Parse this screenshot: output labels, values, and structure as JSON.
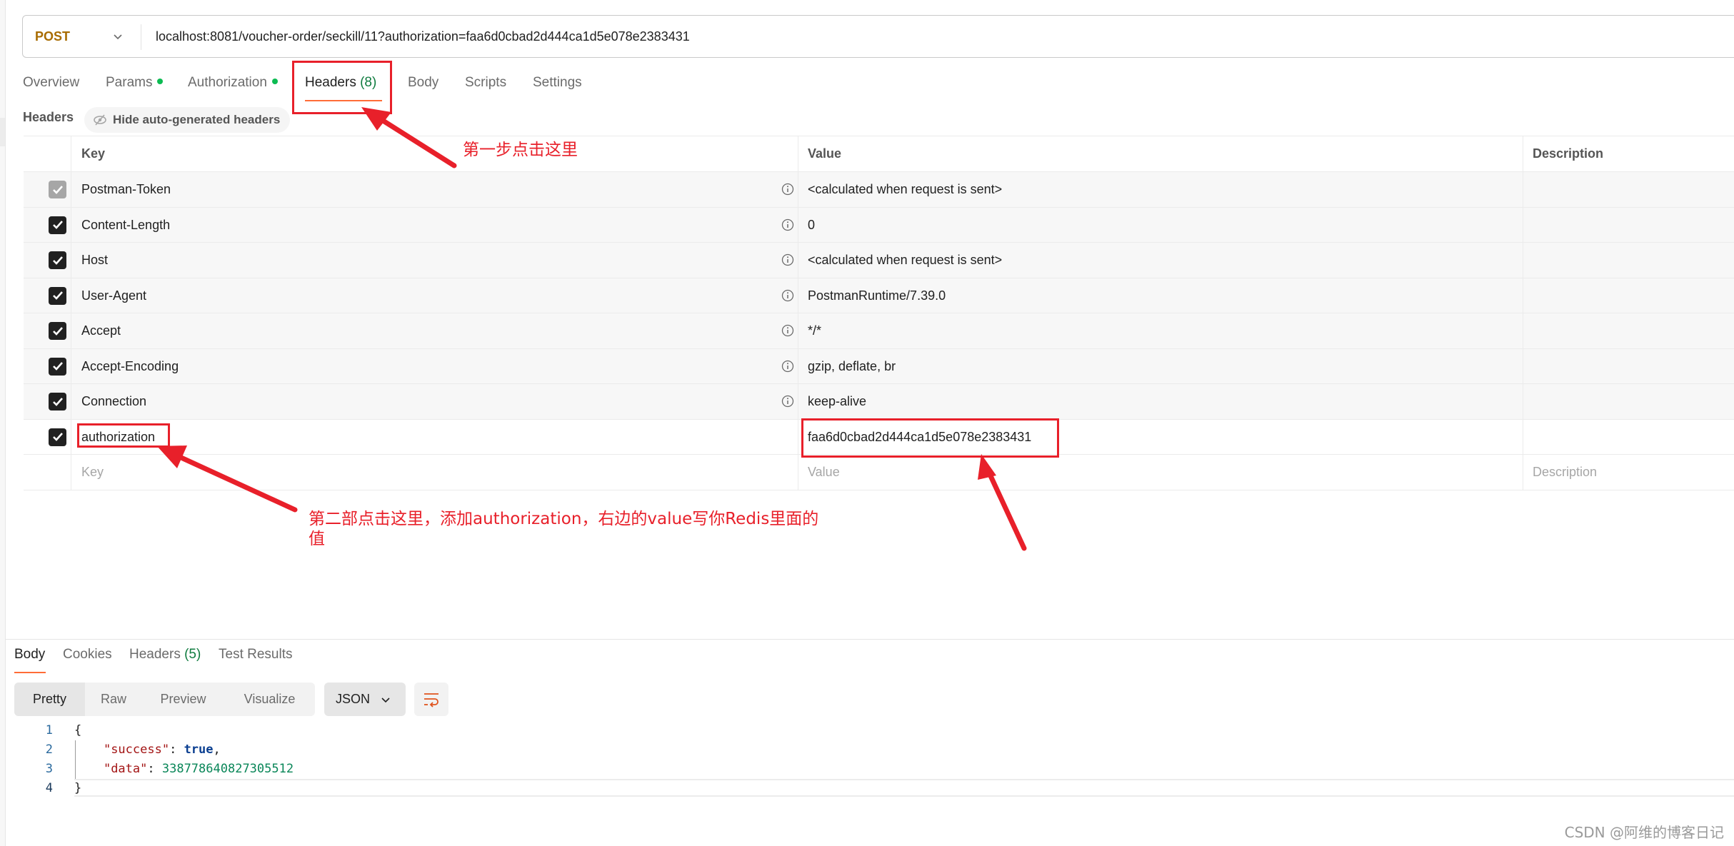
{
  "request": {
    "method": "POST",
    "url": "localhost:8081/voucher-order/seckill/11?authorization=faa6d0cbad2d444ca1d5e078e2383431"
  },
  "request_tabs": [
    {
      "label": "Overview",
      "dot": false
    },
    {
      "label": "Params",
      "dot": true
    },
    {
      "label": "Authorization",
      "dot": true
    },
    {
      "label": "Headers",
      "count": "(8)",
      "active": true
    },
    {
      "label": "Body"
    },
    {
      "label": "Scripts"
    },
    {
      "label": "Settings"
    }
  ],
  "headers_section": {
    "label": "Headers",
    "hide_button": "Hide auto-generated headers"
  },
  "headers_table": {
    "columns": [
      "Key",
      "Value",
      "Description"
    ],
    "rows": [
      {
        "key": "Postman-Token",
        "value": "<calculated when request is sent>",
        "checked": true,
        "auto": true
      },
      {
        "key": "Content-Length",
        "value": "0",
        "checked": true,
        "auto": true
      },
      {
        "key": "Host",
        "value": "<calculated when request is sent>",
        "checked": true,
        "auto": true
      },
      {
        "key": "User-Agent",
        "value": "PostmanRuntime/7.39.0",
        "checked": true,
        "auto": true
      },
      {
        "key": "Accept",
        "value": "*/*",
        "checked": true,
        "auto": true
      },
      {
        "key": "Accept-Encoding",
        "value": "gzip, deflate, br",
        "checked": true,
        "auto": true
      },
      {
        "key": "Connection",
        "value": "keep-alive",
        "checked": true,
        "auto": true
      },
      {
        "key": "authorization",
        "value": "faa6d0cbad2d444ca1d5e078e2383431",
        "checked": true,
        "auto": false
      }
    ],
    "new_row_placeholders": {
      "key": "Key",
      "value": "Value",
      "description": "Description"
    }
  },
  "annotations": {
    "step1": "第一步点击这里",
    "step2_line1": "第二部点击这里，添加authorization，右边的value写你Redis里面的",
    "step2_line2": "值",
    "color": "#e8202a"
  },
  "response": {
    "tabs": [
      {
        "label": "Body",
        "active": true
      },
      {
        "label": "Cookies"
      },
      {
        "label": "Headers",
        "count": "(5)"
      },
      {
        "label": "Test Results"
      }
    ],
    "view_modes": [
      "Pretty",
      "Raw",
      "Preview",
      "Visualize"
    ],
    "active_view": "Pretty",
    "format": "JSON",
    "code_lines": [
      {
        "n": "1",
        "text": "{"
      },
      {
        "n": "2",
        "key": "\"success\"",
        "sep": ": ",
        "value": "true",
        "trail": ","
      },
      {
        "n": "3",
        "key": "\"data\"",
        "sep": ": ",
        "value": "338778640827305512",
        "trail": ""
      },
      {
        "n": "4",
        "text": "}"
      }
    ]
  },
  "watermark": "CSDN @阿维的博客日记",
  "colors": {
    "accent": "#ff6c37",
    "method": "#a86b00",
    "success_dot": "#0cbb52"
  }
}
